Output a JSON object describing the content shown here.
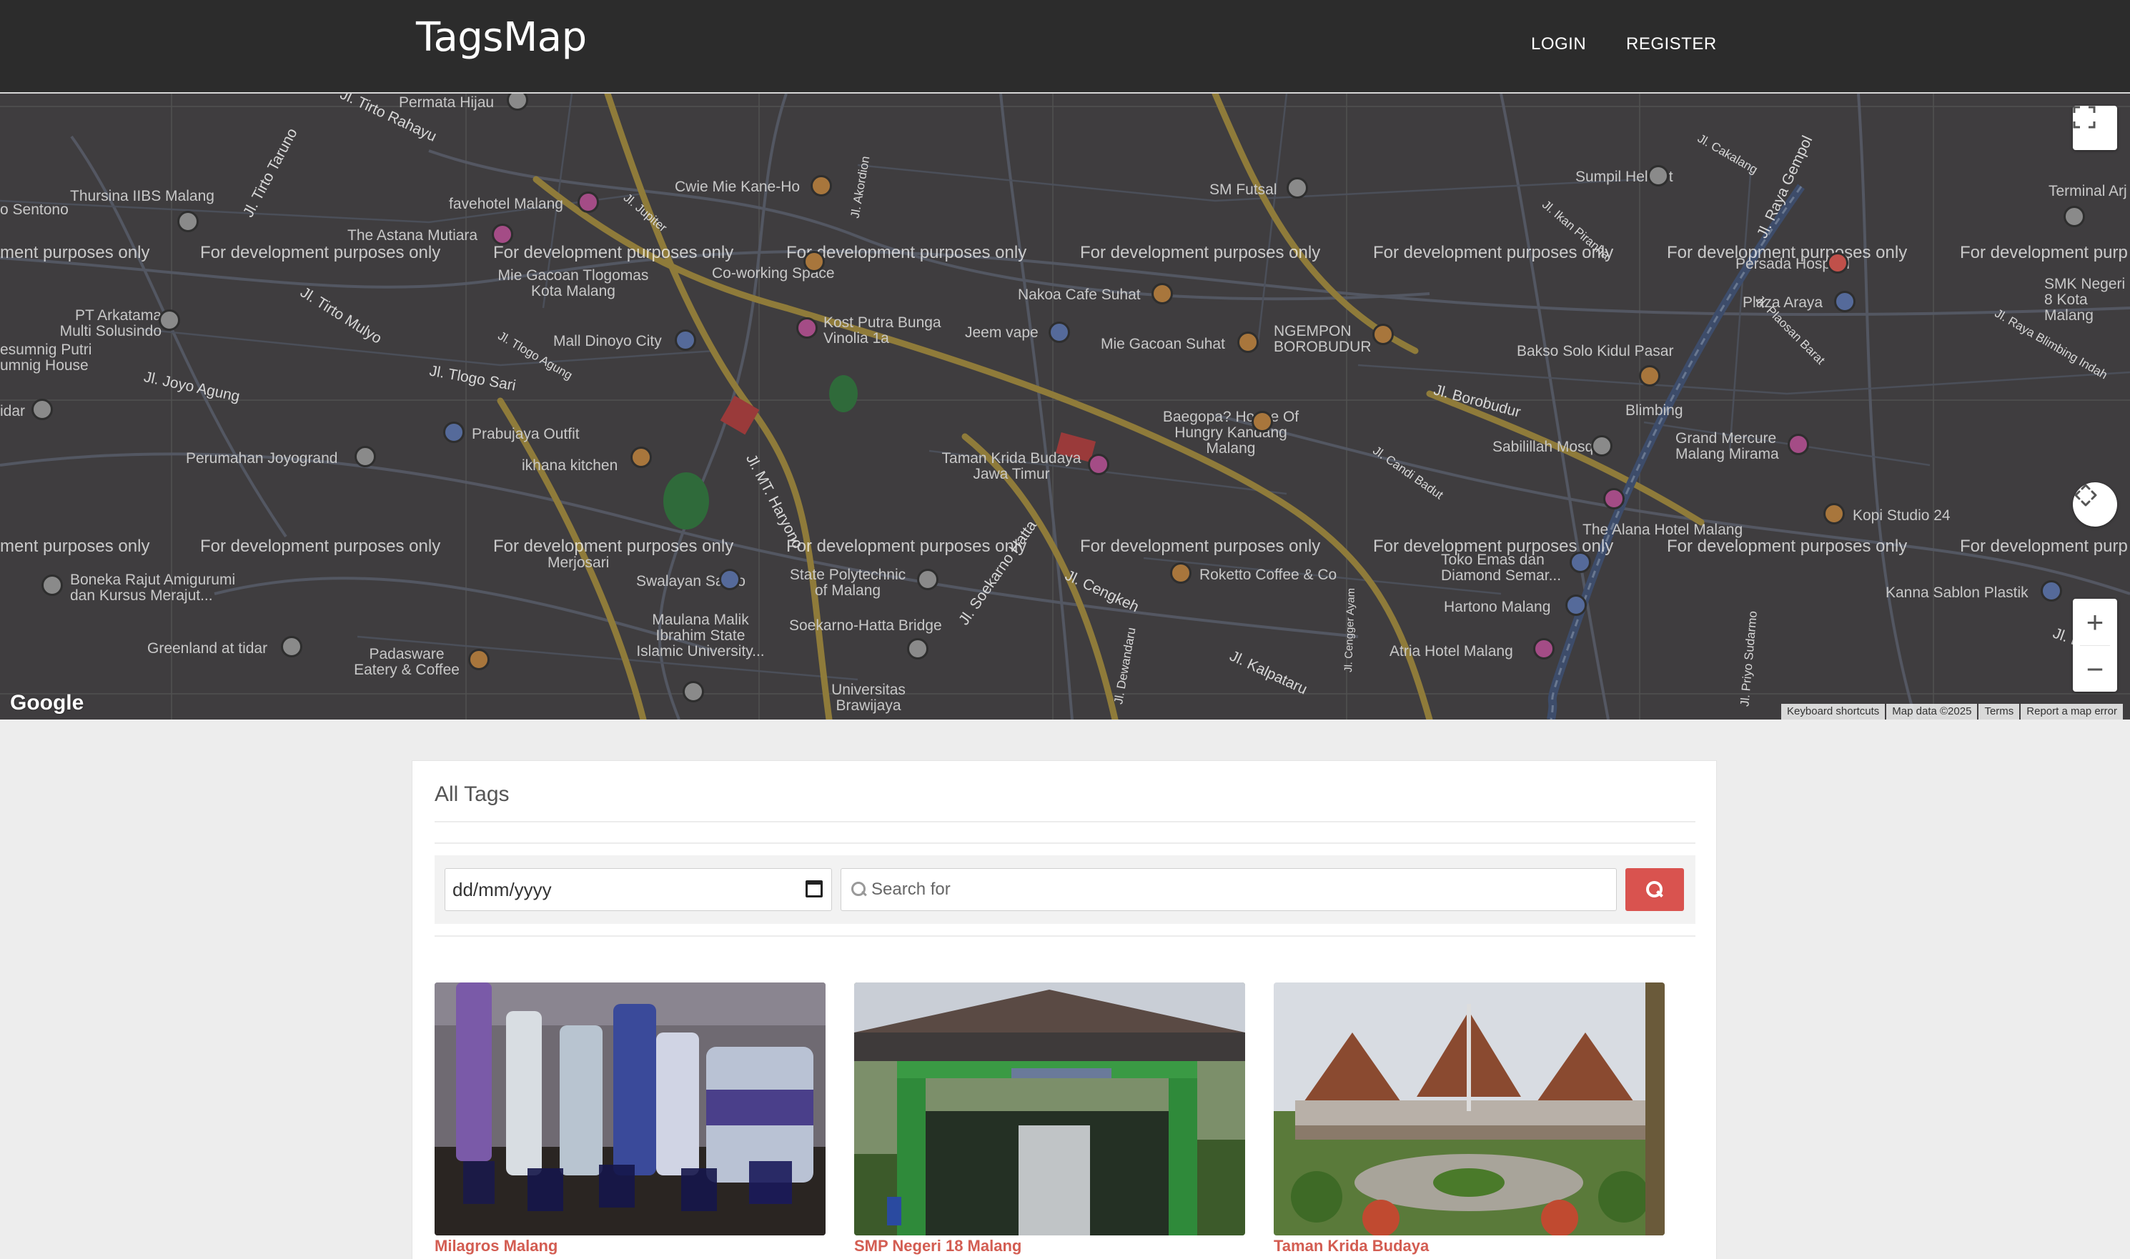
{
  "navbar": {
    "brand": "TagsMap",
    "login": "LOGIN",
    "register": "REGISTER"
  },
  "map": {
    "watermark": "For development purposes only",
    "watermark_clipped_left": "ment purposes only",
    "watermark_clipped_right": "For development purp",
    "google_logo": "Google",
    "attribution": [
      "Keyboard shortcuts",
      "Map data ©2025",
      "Terms",
      "Report a map error"
    ],
    "places": [
      "Permata Hijau",
      "Thursina IIBS Malang",
      "o Sentono",
      "favehotel Malang",
      "The Astana Mutiara",
      "Cwie Mie Kane-Ho",
      "SM Futsal",
      "Sumpil Helmet",
      "Terminal Arj",
      "Mie Gacoan Tlogomas Kota Malang",
      "Co-working Space",
      "Nakoa Cafe Suhat",
      "PT Arkatama Multi Solusindo",
      "Kost Putra Bunga Vinolia 1a",
      "Jeem vape",
      "Mie Gacoan Suhat",
      "NGEMPON BOROBUDUR",
      "Plaza Araya",
      "Persada Hospital",
      "SMK Negeri 8 Kota Malang",
      "esumnig Putri",
      "umnig House",
      "Mall Dinoyo City",
      "Bakso Solo Kidul Pasar",
      "Blimbing",
      "idar",
      "Perumahan Joyogrand",
      "Prabujaya Outfit",
      "Baegopa? House Of Hungry Kandang Malang",
      "Sabilillah Mosque",
      "Grand Mercure Malang Mirama",
      "ikhana kitchen",
      "Taman Krida Budaya Jawa Timur",
      "The Alana Hotel Malang",
      "Kopi Studio 24",
      "Boneka Rajut Amigurumi dan Kursus Merajut...",
      "Merjosari",
      "Swalayan Sardo",
      "State Polytechnic of Malang",
      "Roketto Coffee & Co",
      "Toko Emas dan Diamond Semar...",
      "Hartono Malang",
      "Kanna Sablon Plastik",
      "Soekarno-Hatta Bridge",
      "Greenland at tidar",
      "Padasware Eatery & Coffee",
      "Maulana Malik Ibrahim State Islamic University...",
      "Atria Hotel Malang",
      "Universitas Brawijaya"
    ],
    "roads": [
      "Jl. Tirto Taruno",
      "Jl. Tirto Rahayu",
      "Jl. Tirto Mulyo",
      "Jl. Joyo Agung",
      "Jl. Tlogo Sari",
      "Jl. Tlogo Agung",
      "Jl. Akordion",
      "Jl. Jupiter",
      "Jl. MT. Haryono",
      "Jl. Soekarno Hatta",
      "Jl. Cengkeh",
      "Jl. Kalpataru",
      "Jl. Borobudur",
      "Jl. Candi Badut",
      "Jl. Raya Gempol",
      "Jl. Cakalang",
      "Jl. Ikan Piranha",
      "Jl. Plaosan Barat",
      "Jl. Raya Blimbing Indah",
      "Jl. Dewandaru",
      "Jl. Cengger Ayam",
      "Jl. Laksda",
      "Jl. Priyo Sudarmo"
    ]
  },
  "content": {
    "title": "All Tags",
    "date_placeholder": "dd/mm/yyyy",
    "search_placeholder": "Search for",
    "cards": [
      {
        "name": "Milagros Malang"
      },
      {
        "name": "SMP Negeri 18 Malang"
      },
      {
        "name": "Taman Krida Budaya"
      }
    ]
  },
  "colors": {
    "navbar": "#2c2c2c",
    "accent": "#d9534f",
    "card_title": "#d35d52"
  },
  "icons": [
    "fullscreen-icon",
    "pan-icon",
    "zoom-in-icon",
    "zoom-out-icon",
    "calendar-icon",
    "search-icon"
  ]
}
